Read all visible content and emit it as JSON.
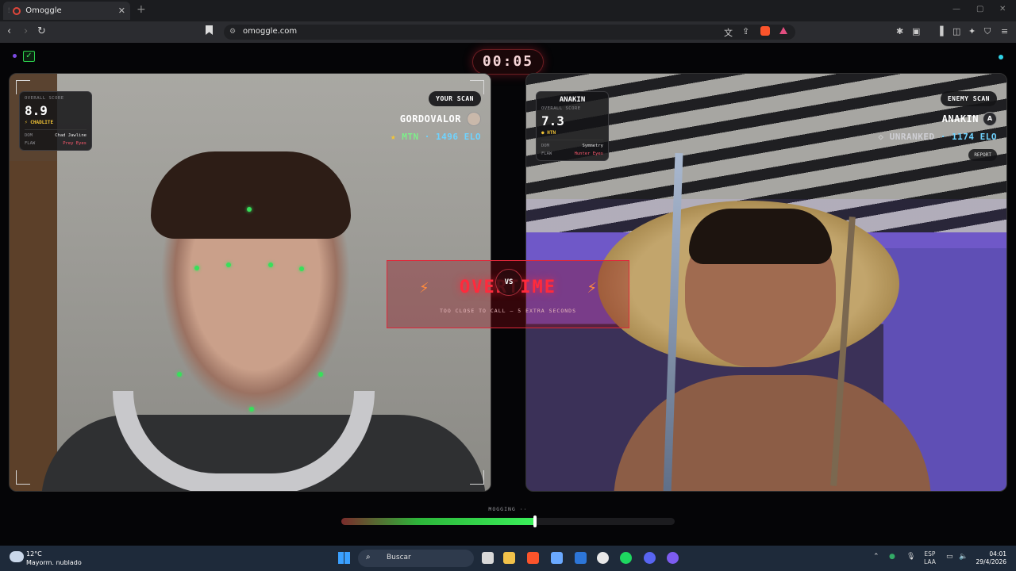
{
  "browser": {
    "tab_title": "Omoggle",
    "url": "omoggle.com"
  },
  "timer": "00:05",
  "left_player": {
    "scan_label": "YOUR SCAN",
    "name": "GORDOVALOR",
    "rank": "MTN",
    "elo": "· 1496 ELO",
    "score_label": "OVERALL SCORE",
    "score": "8.9",
    "tier": "CHADLITE",
    "dom_label": "DOM",
    "dom_value": "Chad Jawline",
    "flaw_label": "FLAW",
    "flaw_value": "Prey Eyes"
  },
  "right_player": {
    "header": "ANAKIN",
    "scan_label": "ENEMY SCAN",
    "name": "ANAKIN",
    "avatar_letter": "A",
    "rank": "UNRANKED",
    "elo": "· 1174 ELO",
    "report_label": "REPORT",
    "score_label": "OVERALL SCORE",
    "score": "7.3",
    "tier": "HTN",
    "dom_label": "DOM",
    "dom_value": "Symmetry",
    "flaw_label": "FLAW",
    "flaw_value": "Hunter Eyes"
  },
  "overtime": {
    "title": "OVERTIME",
    "subtitle": "TOO CLOSE TO CALL — 5 EXTRA SECONDS",
    "vs": "VS"
  },
  "mogging": {
    "label": "MOGGING ··",
    "progress": 0.58
  },
  "taskbar": {
    "temp": "12°C",
    "weather": "Mayorm. nublado",
    "search_placeholder": "Buscar",
    "lang_top": "ESP",
    "lang_bottom": "LAA",
    "time": "04:01",
    "date": "29/4/2026"
  },
  "colors": {
    "accent_red": "#ff2a3c",
    "accent_green": "#3bf05a",
    "elo_cyan": "#6fd3ff",
    "tier_gold": "#f3c536"
  }
}
